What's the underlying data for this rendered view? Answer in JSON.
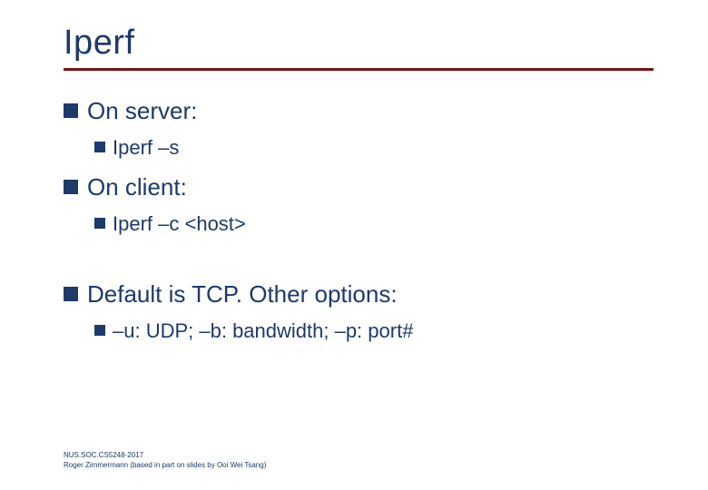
{
  "title": "Iperf",
  "bullets": {
    "server": {
      "label": "On server:",
      "cmd": "Iperf –s"
    },
    "client": {
      "label": "On client:",
      "cmd": "Iperf –c <host>"
    },
    "default": {
      "label": "Default is TCP. Other options:",
      "opts": "–u: UDP; –b: bandwidth; –p: port#"
    }
  },
  "footer": {
    "line1": "NUS.SOC.CS5248-2017",
    "line2": "Roger Zimmermann (based in part on slides by Ooi Wei Tsang)"
  }
}
